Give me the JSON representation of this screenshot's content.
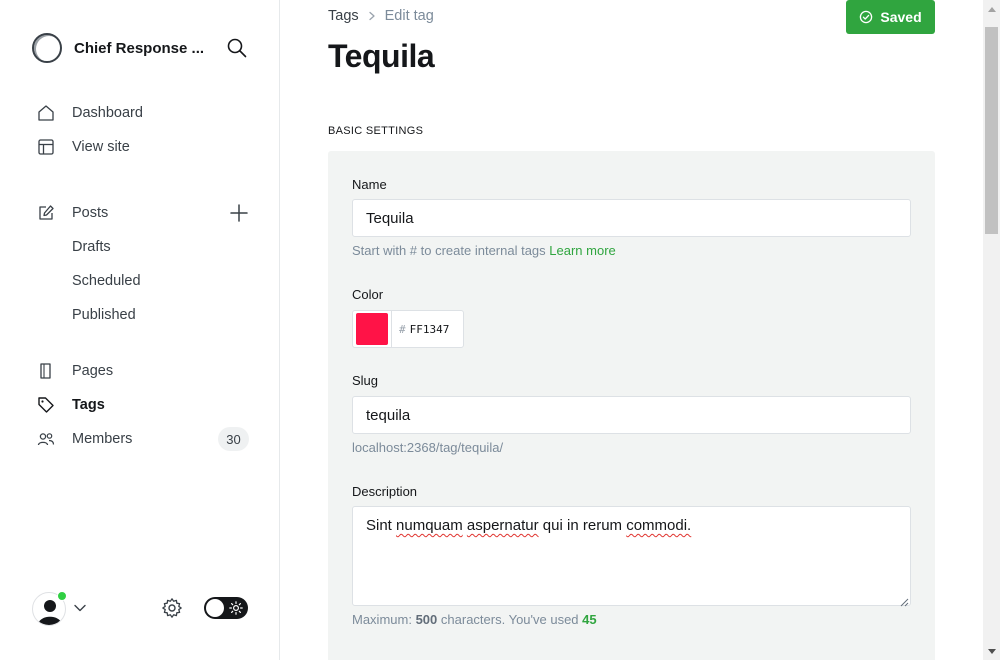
{
  "sidebar": {
    "site_name": "Chief Response ...",
    "nav_primary": [
      {
        "label": "Dashboard",
        "icon": "home-icon"
      },
      {
        "label": "View site",
        "icon": "layout-icon"
      }
    ],
    "posts": {
      "label": "Posts",
      "icon": "edit-icon"
    },
    "posts_sub": [
      {
        "label": "Drafts"
      },
      {
        "label": "Scheduled"
      },
      {
        "label": "Published"
      }
    ],
    "nav_secondary": [
      {
        "label": "Pages",
        "icon": "page-icon"
      },
      {
        "label": "Tags",
        "icon": "tag-icon"
      },
      {
        "label": "Members",
        "icon": "members-icon"
      }
    ],
    "members_count": "30"
  },
  "header": {
    "breadcrumb_parent": "Tags",
    "breadcrumb_current": "Edit tag",
    "title": "Tequila",
    "saved_label": "Saved"
  },
  "form": {
    "section_title": "BASIC SETTINGS",
    "name_label": "Name",
    "name_value": "Tequila",
    "name_hint": "Start with # to create internal tags",
    "name_hint_link": "Learn more",
    "color_label": "Color",
    "color_hash": "#",
    "color_value": "FF1347",
    "slug_label": "Slug",
    "slug_value": "tequila",
    "slug_url": "localhost:2368/tag/tequila/",
    "description_label": "Description",
    "description_words": [
      "Sint",
      "numquam",
      "aspernatur",
      "qui",
      "in",
      "rerum",
      "commodi."
    ],
    "desc_hint_prefix": "Maximum:",
    "desc_hint_max": "500",
    "desc_hint_mid": "characters. You've used",
    "desc_hint_used": "45"
  },
  "colors": {
    "accent": "#30a53f",
    "tag_color": "#ff1347",
    "online": "#30cf43"
  }
}
